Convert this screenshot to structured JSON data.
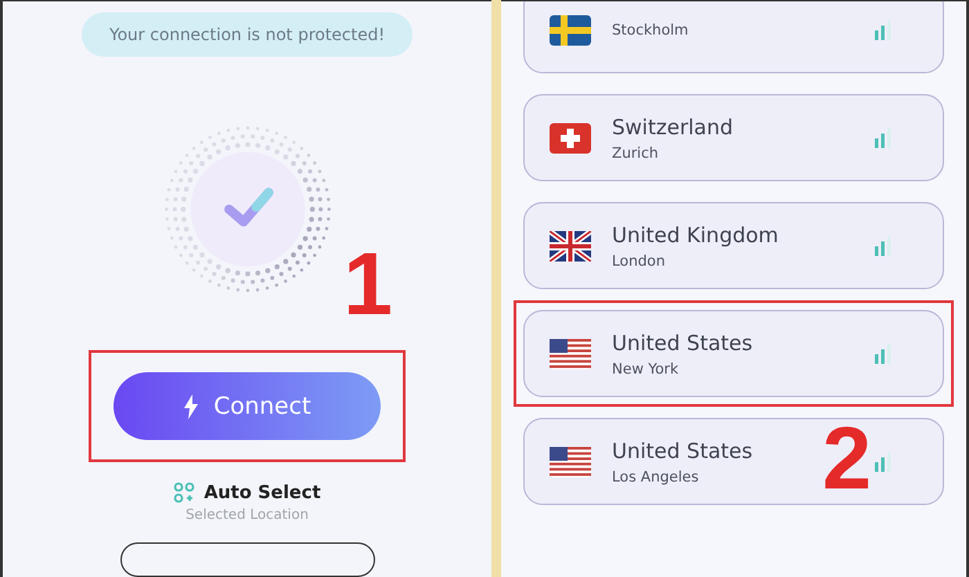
{
  "status_banner": {
    "text": "Your connection is not protected!"
  },
  "connect": {
    "label": "Connect",
    "highlighted": true,
    "marker": "1"
  },
  "location": {
    "title": "Auto Select",
    "subtitle": "Selected Location"
  },
  "servers": [
    {
      "kind": "sweden",
      "city": "Stockholm",
      "highlighted": false
    },
    {
      "kind": "switzerland",
      "country": "Switzerland",
      "city": "Zurich",
      "highlighted": false
    },
    {
      "kind": "uk",
      "country": "United Kingdom",
      "city": "London",
      "highlighted": false
    },
    {
      "kind": "usa",
      "country": "United States",
      "city": "New York",
      "highlighted": true
    },
    {
      "kind": "usa",
      "country": "United States",
      "city": "Los Angeles",
      "highlighted": false
    }
  ],
  "server_marker": "2"
}
